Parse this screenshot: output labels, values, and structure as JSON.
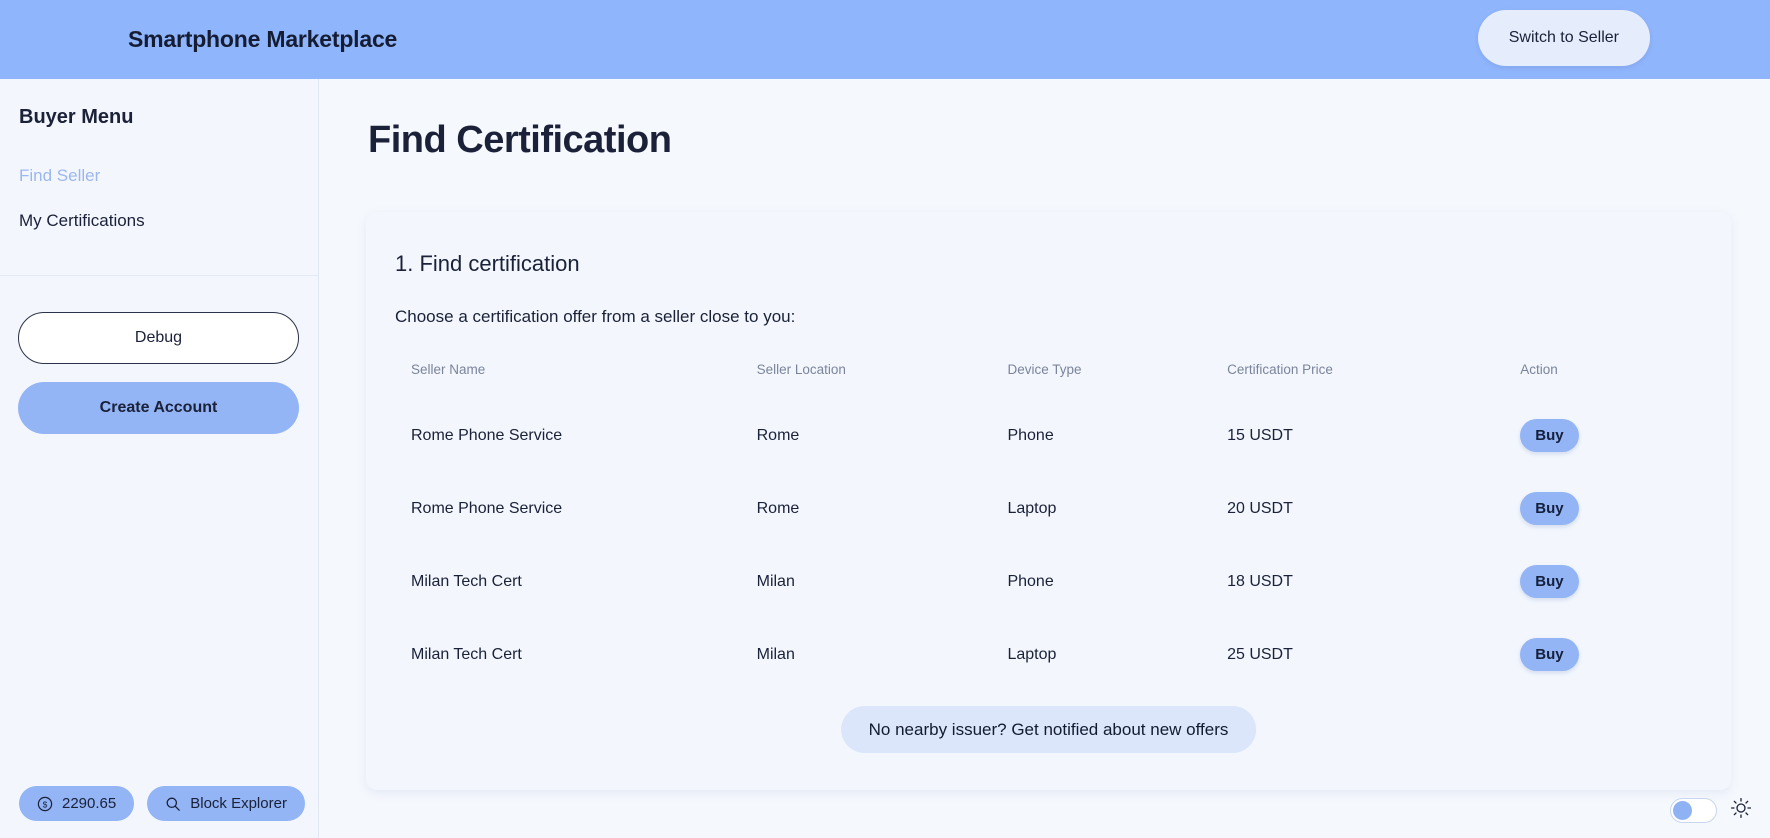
{
  "header": {
    "title": "Smartphone Marketplace",
    "switch_label": "Switch to Seller",
    "bg_color": "#8FB5FC"
  },
  "sidebar": {
    "heading": "Buyer Menu",
    "items": [
      {
        "label": "Find Seller",
        "active": true
      },
      {
        "label": "My Certifications",
        "active": false
      }
    ],
    "debug_label": "Debug",
    "create_account_label": "Create Account"
  },
  "status_bar": {
    "balance_icon": "dollar-circle-icon",
    "balance": "2290.65",
    "explorer_icon": "search-icon",
    "explorer_label": "Block Explorer"
  },
  "main": {
    "page_title": "Find Certification",
    "card": {
      "title": "1. Find certification",
      "subtitle": "Choose a certification offer from a seller close to you:",
      "table": {
        "columns": [
          "Seller Name",
          "Seller Location",
          "Device Type",
          "Certification Price",
          "Action"
        ],
        "rows": [
          {
            "seller_name": "Rome Phone Service",
            "location": "Rome",
            "device": "Phone",
            "price": "15 USDT",
            "action": "Buy"
          },
          {
            "seller_name": "Rome Phone Service",
            "location": "Rome",
            "device": "Laptop",
            "price": "20 USDT",
            "action": "Buy"
          },
          {
            "seller_name": "Milan Tech Cert",
            "location": "Milan",
            "device": "Phone",
            "price": "18 USDT",
            "action": "Buy"
          },
          {
            "seller_name": "Milan Tech Cert",
            "location": "Milan",
            "device": "Laptop",
            "price": "25 USDT",
            "action": "Buy"
          }
        ]
      },
      "notify_label": "No nearby issuer? Get notified about new offers"
    }
  },
  "theme": {
    "toggle_state": "off",
    "icon": "sun-icon"
  },
  "colors": {
    "accent": "#93B4F5",
    "header": "#8FB5FC",
    "page_bg": "#F3F6FD",
    "card_bg": "#F3F7FD",
    "text": "#1A2138",
    "muted": "#7A849B"
  }
}
